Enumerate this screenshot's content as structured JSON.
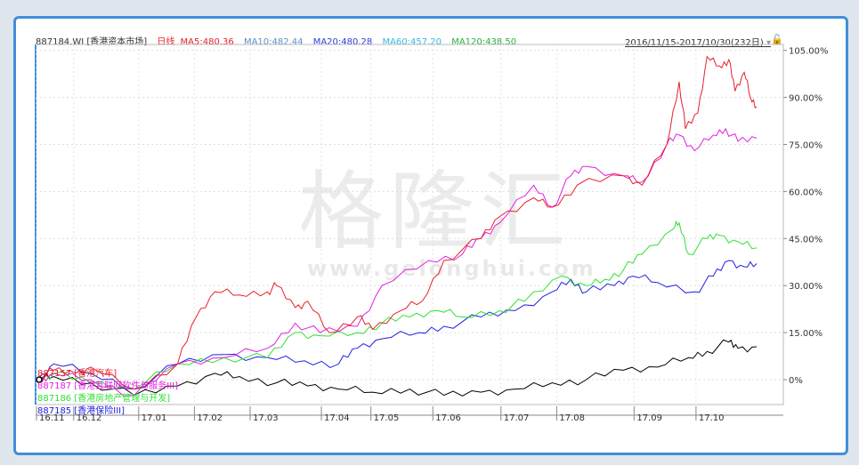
{
  "header": {
    "code": "887184.WI [香港资本市场]",
    "period": "日线",
    "ma5": "MA5:480.36",
    "ma10": "MA10:482.44",
    "ma20": "MA20:480.28",
    "ma60": "MA60:457.20",
    "ma120": "MA120:438.50",
    "range": "2016/11/15-2017/10/30(232日)",
    "dropdown": "▾",
    "lock": "🔓"
  },
  "colors": {
    "ma5": "#e8202a",
    "ma10": "#5a8fc8",
    "ma20": "#2b3fd6",
    "ma60": "#37b8e0",
    "ma120": "#28b040"
  },
  "watermark": {
    "logo": "格隆汇",
    "url": "www.gelonghui.com"
  },
  "chart_data": {
    "type": "line",
    "x_unit": "trading day index (0-232)",
    "xlim": [
      0,
      232
    ],
    "ylim": [
      -10,
      110
    ],
    "y_ticks": [
      "105.00%",
      "90.00%",
      "75.00%",
      "60.00%",
      "45.00%",
      "30.00%",
      "15.00%",
      "0%"
    ],
    "y_tick_values": [
      105,
      90,
      75,
      60,
      45,
      30,
      15,
      0
    ],
    "x_ticks": [
      "16.11",
      "16.12",
      "17.01",
      "17.02",
      "17.03",
      "17.04",
      "17.05",
      "17.06",
      "17.07",
      "17.08",
      "17.09",
      "17.10"
    ],
    "x_tick_values": [
      0,
      12,
      33,
      51,
      69,
      92,
      108,
      128,
      150,
      168,
      193,
      213
    ],
    "series": [
      {
        "name": "887184.WI",
        "label": "",
        "color": "#000000",
        "points": [
          [
            0,
            0
          ],
          [
            5,
            1
          ],
          [
            17,
            -1
          ],
          [
            31,
            -5
          ],
          [
            45,
            -2
          ],
          [
            57,
            2
          ],
          [
            65,
            1
          ],
          [
            77,
            -1
          ],
          [
            87,
            -2
          ],
          [
            97,
            -3
          ],
          [
            108,
            -4
          ],
          [
            120,
            -3
          ],
          [
            131,
            -5
          ],
          [
            143,
            -4
          ],
          [
            154,
            -3
          ],
          [
            166,
            -1
          ],
          [
            177,
            0
          ],
          [
            189,
            3
          ],
          [
            200,
            4
          ],
          [
            210,
            7
          ],
          [
            216,
            9
          ],
          [
            223,
            12
          ],
          [
            226,
            10
          ],
          [
            232,
            10.5
          ]
        ]
      },
      {
        "name": "887157",
        "label": "887157 [香港汽车]",
        "color": "#e8202a",
        "points": [
          [
            0,
            0
          ],
          [
            5,
            3
          ],
          [
            12,
            2
          ],
          [
            17,
            4
          ],
          [
            31,
            -3
          ],
          [
            45,
            5
          ],
          [
            51,
            20
          ],
          [
            57,
            28
          ],
          [
            65,
            27
          ],
          [
            74,
            28
          ],
          [
            77,
            30
          ],
          [
            83,
            23
          ],
          [
            87,
            25
          ],
          [
            94,
            15
          ],
          [
            103,
            20
          ],
          [
            108,
            16
          ],
          [
            117,
            22
          ],
          [
            124,
            25
          ],
          [
            131,
            38
          ],
          [
            143,
            45
          ],
          [
            149,
            52
          ],
          [
            160,
            58
          ],
          [
            166,
            55
          ],
          [
            174,
            62
          ],
          [
            189,
            65
          ],
          [
            195,
            62
          ],
          [
            203,
            75
          ],
          [
            207,
            95
          ],
          [
            209,
            80
          ],
          [
            213,
            85
          ],
          [
            216,
            103
          ],
          [
            220,
            100
          ],
          [
            223,
            102
          ],
          [
            225,
            92
          ],
          [
            228,
            98
          ],
          [
            230,
            90
          ],
          [
            232,
            87
          ]
        ]
      },
      {
        "name": "887187",
        "label": "887187 [香港互联网软件与服务III]",
        "color": "#e020e0",
        "points": [
          [
            0,
            0
          ],
          [
            5,
            2
          ],
          [
            17,
            0
          ],
          [
            31,
            -5
          ],
          [
            45,
            5
          ],
          [
            60,
            7
          ],
          [
            74,
            10
          ],
          [
            83,
            18
          ],
          [
            91,
            15
          ],
          [
            103,
            17
          ],
          [
            111,
            30
          ],
          [
            126,
            38
          ],
          [
            137,
            40
          ],
          [
            143,
            45
          ],
          [
            149,
            50
          ],
          [
            160,
            62
          ],
          [
            166,
            55
          ],
          [
            172,
            65
          ],
          [
            177,
            68
          ],
          [
            189,
            65
          ],
          [
            195,
            63
          ],
          [
            203,
            75
          ],
          [
            207,
            78
          ],
          [
            212,
            73
          ],
          [
            218,
            78
          ],
          [
            222,
            80
          ],
          [
            226,
            76
          ],
          [
            232,
            77
          ]
        ]
      },
      {
        "name": "887186",
        "label": "887186 [香港房地产管理与开发]",
        "color": "#30e030",
        "points": [
          [
            0,
            0
          ],
          [
            5,
            2
          ],
          [
            17,
            -1
          ],
          [
            31,
            -3
          ],
          [
            45,
            5
          ],
          [
            60,
            7
          ],
          [
            74,
            7
          ],
          [
            83,
            15
          ],
          [
            91,
            14
          ],
          [
            103,
            15
          ],
          [
            111,
            18
          ],
          [
            120,
            20
          ],
          [
            129,
            22
          ],
          [
            137,
            20
          ],
          [
            149,
            22
          ],
          [
            157,
            25
          ],
          [
            169,
            33
          ],
          [
            177,
            30
          ],
          [
            183,
            32
          ],
          [
            189,
            35
          ],
          [
            195,
            40
          ],
          [
            205,
            48
          ],
          [
            207,
            50
          ],
          [
            210,
            40
          ],
          [
            216,
            45
          ],
          [
            220,
            46
          ],
          [
            226,
            44
          ],
          [
            232,
            42
          ]
        ]
      },
      {
        "name": "887185",
        "label": "887185 [香港保险III]",
        "color": "#2020e0",
        "points": [
          [
            0,
            0
          ],
          [
            5,
            5
          ],
          [
            17,
            2
          ],
          [
            31,
            -3
          ],
          [
            45,
            5
          ],
          [
            60,
            8
          ],
          [
            74,
            7
          ],
          [
            86,
            6
          ],
          [
            97,
            5
          ],
          [
            103,
            10
          ],
          [
            111,
            13
          ],
          [
            123,
            15
          ],
          [
            131,
            17
          ],
          [
            143,
            20
          ],
          [
            154,
            22
          ],
          [
            166,
            28
          ],
          [
            172,
            32
          ],
          [
            177,
            28
          ],
          [
            186,
            30
          ],
          [
            192,
            33
          ],
          [
            200,
            31
          ],
          [
            212,
            28
          ],
          [
            218,
            33
          ],
          [
            223,
            38
          ],
          [
            228,
            36
          ],
          [
            232,
            37
          ]
        ]
      }
    ]
  }
}
